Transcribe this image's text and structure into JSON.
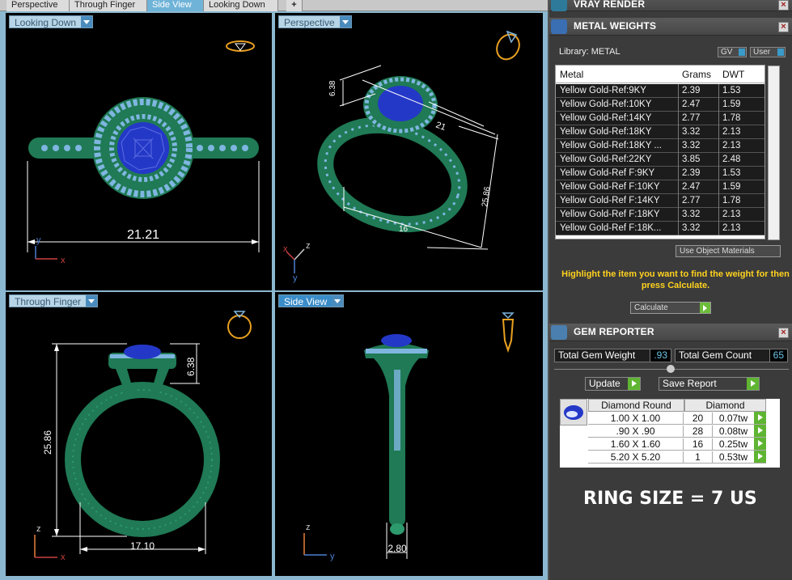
{
  "tabs": [
    "Perspective",
    "Through Finger",
    "Side View",
    "Looking Down",
    "+"
  ],
  "active_tab": "Side View",
  "viewports": {
    "top_left": {
      "label": "Looking Down",
      "dim": "21.21",
      "axis_a": "y",
      "axis_b": "x"
    },
    "top_right": {
      "label": "Perspective",
      "dim_a": "6.38",
      "dim_b": "21",
      "dim_c": "25.86",
      "dim_d": "16",
      "axis_a": "z",
      "axis_b": "x",
      "axis_c": "y"
    },
    "bottom_left": {
      "label": "Through Finger",
      "dim_height": "25.86",
      "dim_head": "6.38",
      "dim_width": "17.10",
      "axis_a": "z",
      "axis_b": "x"
    },
    "bottom_right": {
      "label": "Side View",
      "dim_width": "2.80",
      "axis_a": "z",
      "axis_b": "y"
    }
  },
  "panel": {
    "vray": {
      "title": "VRAY RENDER"
    },
    "metal": {
      "title": "METAL WEIGHTS",
      "library": "Library: METAL",
      "gv": "GV",
      "user": "User",
      "columns": [
        "Metal",
        "Grams",
        "DWT"
      ],
      "rows": [
        [
          "Yellow Gold-Ref:9KY",
          "2.39",
          "1.53"
        ],
        [
          "Yellow Gold-Ref:10KY",
          "2.47",
          "1.59"
        ],
        [
          "Yellow Gold-Ref:14KY",
          "2.77",
          "1.78"
        ],
        [
          "Yellow Gold-Ref:18KY",
          "3.32",
          "2.13"
        ],
        [
          "Yellow Gold-Ref:18KY ...",
          "3.32",
          "2.13"
        ],
        [
          "Yellow Gold-Ref:22KY",
          "3.85",
          "2.48"
        ],
        [
          "Yellow Gold-Ref F:9KY",
          "2.39",
          "1.53"
        ],
        [
          "Yellow Gold-Ref F:10KY",
          "2.47",
          "1.59"
        ],
        [
          "Yellow Gold-Ref F:14KY",
          "2.77",
          "1.78"
        ],
        [
          "Yellow Gold-Ref F:18KY",
          "3.32",
          "2.13"
        ],
        [
          "Yellow Gold-Ref F:18K...",
          "3.32",
          "2.13"
        ]
      ],
      "use_object_materials": "Use Object Materials",
      "hint": "Highlight the item you want to find the weight for then press Calculate.",
      "calculate": "Calculate"
    },
    "gem": {
      "title": "GEM REPORTER",
      "total_weight_label": "Total Gem Weight",
      "total_weight": ".93",
      "total_count_label": "Total Gem Count",
      "total_count": "65",
      "update": "Update",
      "save_report": "Save Report",
      "header_shape": "Diamond Round",
      "header_type": "Diamond",
      "rows": [
        [
          "1.00 X 1.00",
          "20",
          "0.07tw"
        ],
        [
          ".90 X .90",
          "28",
          "0.08tw"
        ],
        [
          "1.60 X 1.60",
          "16",
          "0.25tw"
        ],
        [
          "5.20 X 5.20",
          "1",
          "0.53tw"
        ]
      ]
    },
    "ring_size": "RING SIZE = 7 US"
  },
  "colors": {
    "metal_green": "#1f7a55",
    "pave_blue": "#7fb6e0",
    "gem_blue": "#2438c8",
    "active_tab": "#6fb3d8",
    "hint_yellow": "#ffd21f"
  }
}
